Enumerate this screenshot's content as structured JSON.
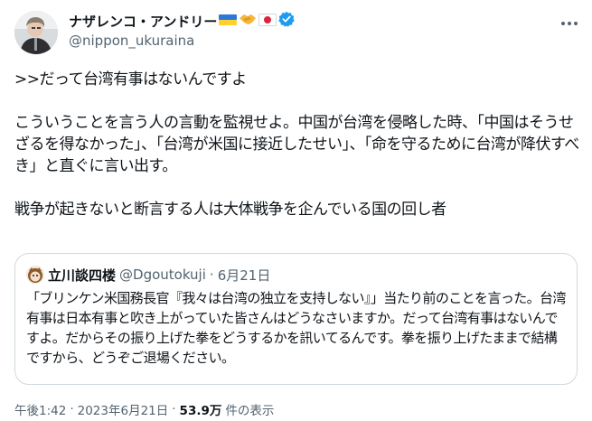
{
  "author": {
    "display_name": "ナザレンコ・アンドリー",
    "handle": "@nippon_ukuraina",
    "flag_icons": [
      "ukraine-flag-icon",
      "handshake-icon",
      "japan-flag-icon"
    ],
    "verified": true
  },
  "tweet": {
    "paragraphs": [
      ">>だって台湾有事はないんですよ",
      "こういうことを言う人の言動を監視せよ。中国が台湾を侵略した時、「中国はそうせざるを得なかった」、「台湾が米国に接近したせい」、「命を守るために台湾が降伏すべき」と直ぐに言い出す。",
      "戦争が起きないと断言する人は大体戦争を企んでいる国の回し者"
    ]
  },
  "quote": {
    "display_name": "立川談四楼",
    "handle": "@Dgoutokuji",
    "separator": "·",
    "date": "6月21日",
    "text": "「ブリンケン米国務長官『我々は台湾の独立を支持しない』」当たり前のことを言った。台湾有事は日本有事と吹き上がっていた皆さんはどうなさいますか。だって台湾有事はないんですよ。だからその振り上げた拳をどうするかを訊いてるんです。拳を振り上げたままで結構ですから、どうぞご退場ください。"
  },
  "meta": {
    "time": "午後1:42",
    "separator": "·",
    "date": "2023年6月21日",
    "views_count": "53.9万",
    "views_label": "件の表示"
  },
  "colors": {
    "text_primary": "#0f1419",
    "text_secondary": "#536471",
    "verified_blue": "#1d9bf0",
    "border": "#cfd9de"
  }
}
